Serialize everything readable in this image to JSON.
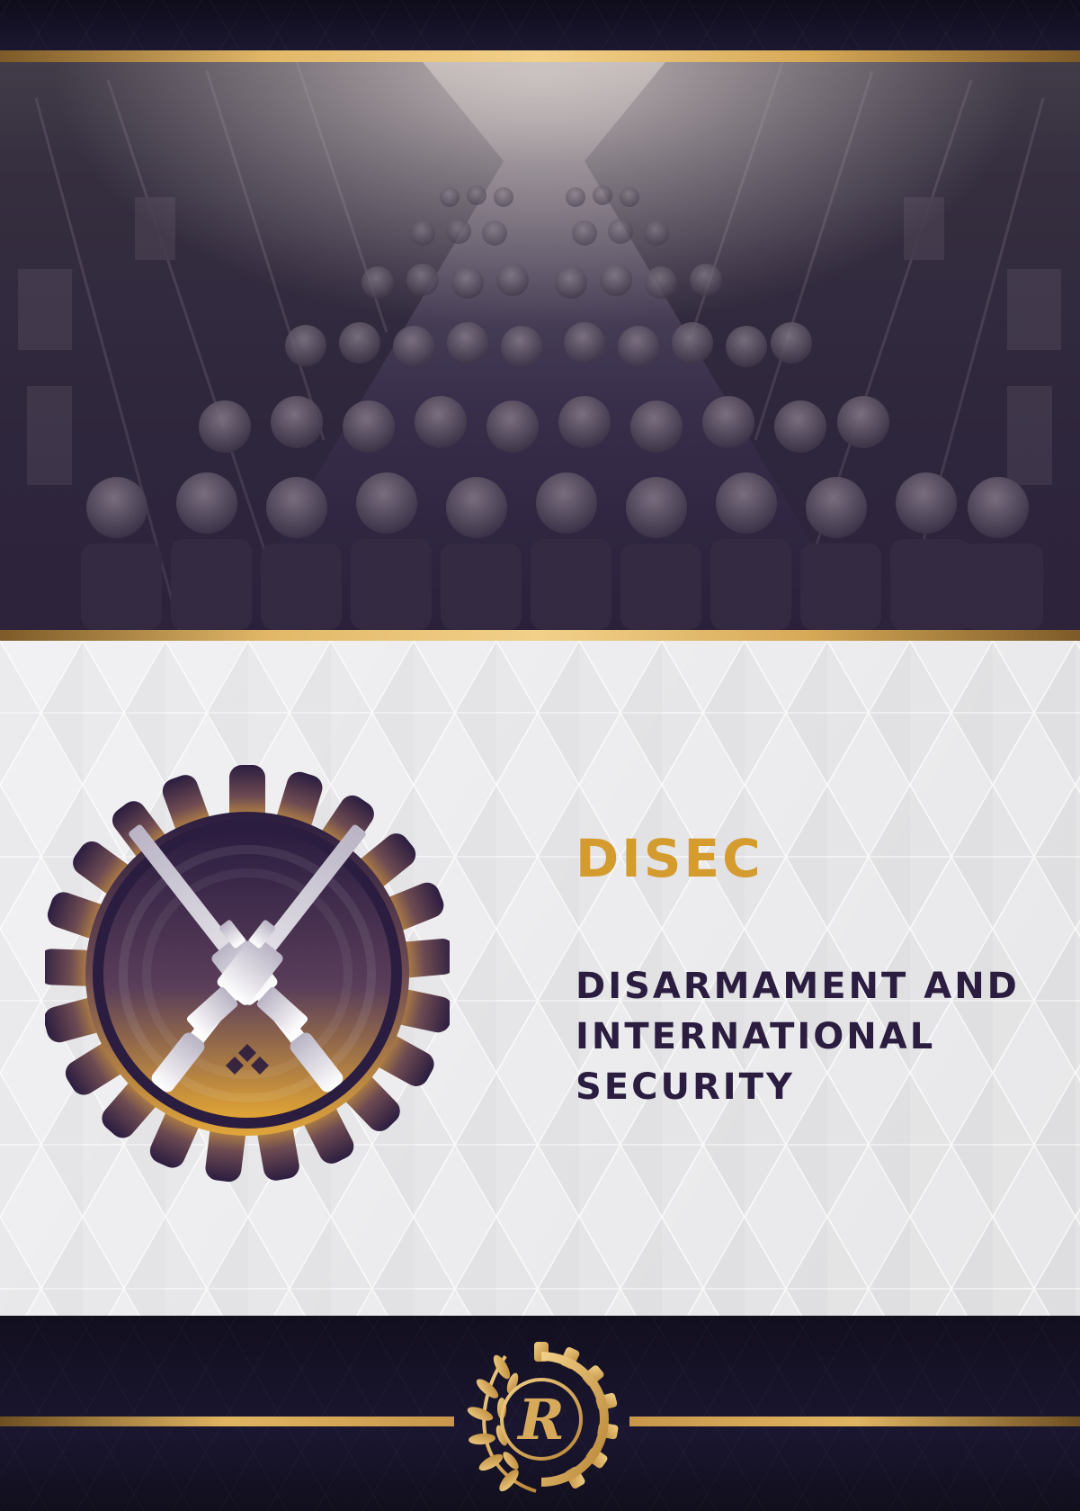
{
  "committee": {
    "acronym": "DISEC",
    "fullname_lines": [
      "DISARMAMENT AND",
      "INTERNATIONAL",
      "SECURITY"
    ]
  },
  "hero": {
    "subject": "troops-seated-in-transport-aircraft"
  },
  "emblem": {
    "icon": "crossed-rifles-gear-emblem"
  },
  "footer": {
    "logo_letter": "R",
    "icon": "laurel-gear-monogram-logo"
  },
  "colors": {
    "gold": "#d49b2f",
    "deep_purple": "#2b1d40",
    "navy_band": "#1a1630",
    "background_light": "#f1f1f3"
  }
}
